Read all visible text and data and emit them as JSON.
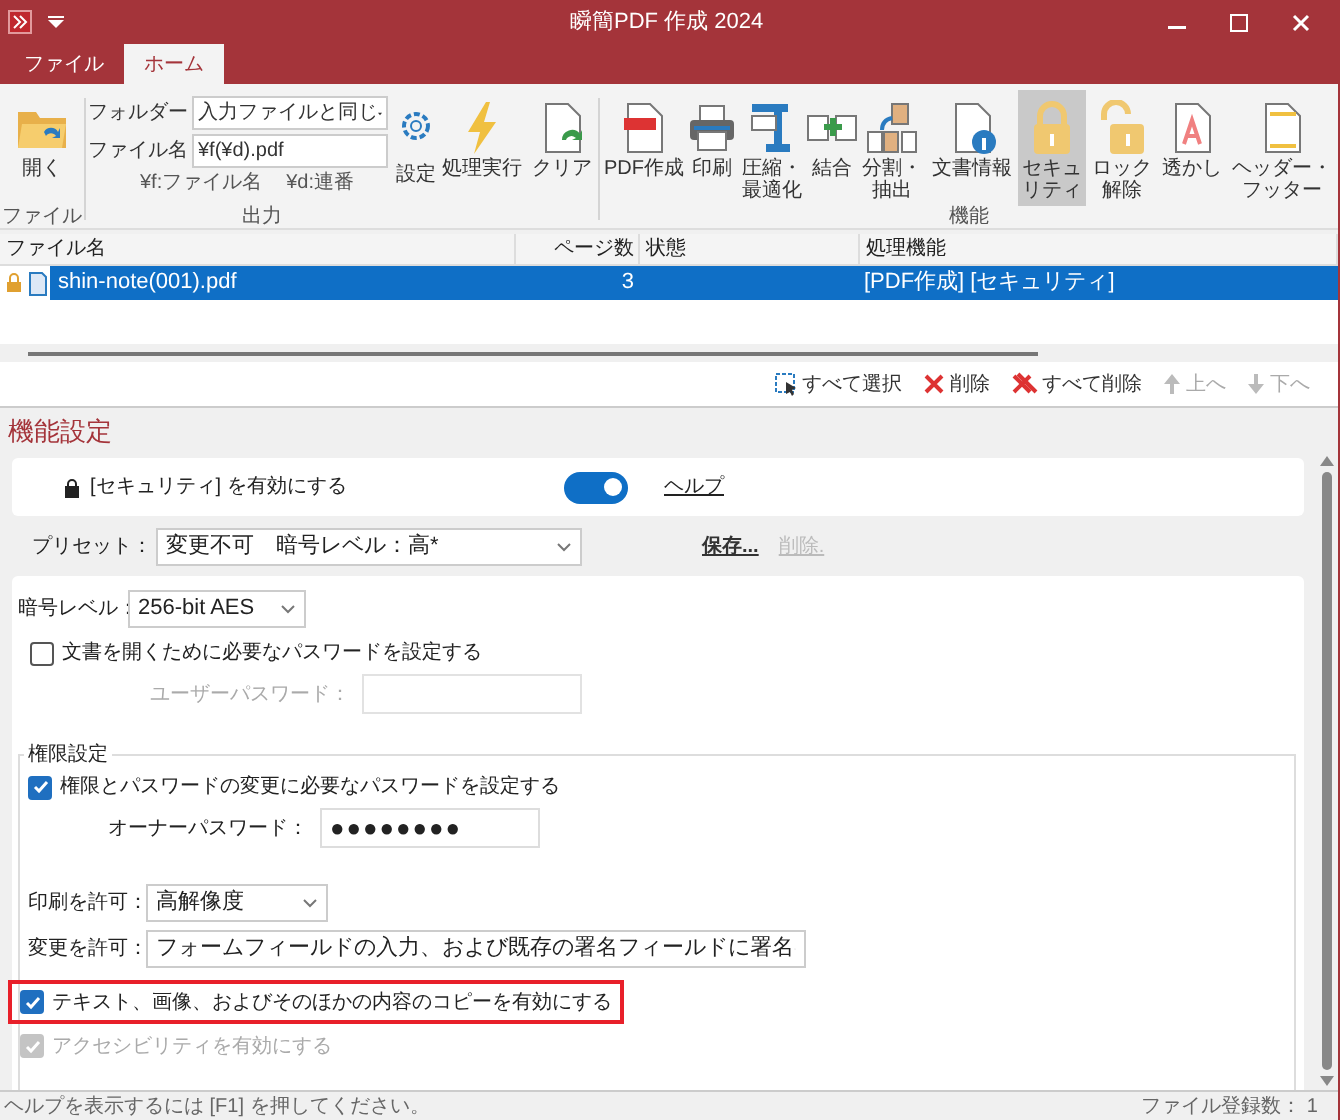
{
  "window": {
    "title": "瞬簡PDF 作成 2024"
  },
  "tabs": [
    {
      "label": "ファイル",
      "selected": false
    },
    {
      "label": "ホーム",
      "selected": true
    }
  ],
  "ribbon": {
    "groups": [
      {
        "kind": "buttons",
        "label": "ファイル",
        "buttons": [
          {
            "label": "開く",
            "selected": false
          }
        ]
      },
      {
        "kind": "output",
        "label": "出力",
        "folder_label": "フォルダー",
        "folder_value": "入力ファイルと同じ",
        "filename_label": "ファイル名",
        "filename_value": "¥f(¥d).pdf",
        "hints": [
          "¥f:ファイル名",
          "¥d:連番"
        ],
        "settings_button": "設定"
      },
      {
        "kind": "buttons",
        "buttons": [
          {
            "label": "処理実行",
            "selected": false
          },
          {
            "label": "クリア",
            "selected": false
          }
        ]
      },
      {
        "kind": "buttons",
        "label": "機能",
        "buttons": [
          {
            "label": "PDF作成",
            "selected": false
          },
          {
            "label": "印刷",
            "selected": false
          },
          {
            "label": "圧縮・最適化",
            "selected": false
          },
          {
            "label": "結合",
            "selected": false
          },
          {
            "label": "分割・抽出",
            "selected": false
          },
          {
            "label": "文書情報",
            "selected": false
          },
          {
            "label": "セキュリティ",
            "selected": true
          },
          {
            "label": "ロック解除",
            "selected": false
          },
          {
            "label": "透かし",
            "selected": false
          },
          {
            "label": "ヘッダー・フッター",
            "selected": false
          }
        ]
      }
    ]
  },
  "table": {
    "columns": [
      "ファイル名",
      "ページ数",
      "状態",
      "処理機能"
    ],
    "rows": [
      {
        "file": "shin-note(001).pdf",
        "pages": "3",
        "status": "",
        "functions": "[PDF作成] [セキュリティ]",
        "selected": true
      }
    ]
  },
  "list_toolbar": [
    {
      "label": "すべて選択",
      "disabled": false
    },
    {
      "label": "削除",
      "disabled": false
    },
    {
      "label": "すべて削除",
      "disabled": false
    },
    {
      "label": "上へ",
      "disabled": true
    },
    {
      "label": "下へ",
      "disabled": true
    }
  ],
  "settings": {
    "heading": "機能設定",
    "enable": {
      "label": "[セキュリティ] を有効にする",
      "on": true,
      "help": "ヘルプ"
    },
    "preset": {
      "label": "プリセット：",
      "value": "変更不可　暗号レベル：高*",
      "save": "保存...",
      "delete": "削除.",
      "delete_disabled": true
    },
    "encryption": {
      "label": "暗号レベル：",
      "value": "256-bit AES"
    },
    "open_password": {
      "label": "文書を開くために必要なパスワードを設定する",
      "checked": false,
      "field_label": "ユーザーパスワード：",
      "disabled": true
    },
    "permissions": {
      "legend": "権限設定",
      "owner": {
        "label": "権限とパスワードの変更に必要なパスワードを設定する",
        "checked": true,
        "field_label": "オーナーパスワード：",
        "value": "●●●●●●●●"
      },
      "print": {
        "label": "印刷を許可：",
        "value": "高解像度"
      },
      "change": {
        "label": "変更を許可：",
        "value": "フォームフィールドの入力、および既存の署名フィールドに署名"
      },
      "options": [
        {
          "label": "テキスト、画像、およびそのほかの内容のコピーを有効にする",
          "checked": true,
          "disabled": false,
          "highlighted": true
        },
        {
          "label": "アクセシビリティを有効にする",
          "checked": true,
          "disabled": true,
          "highlighted": false
        }
      ]
    }
  },
  "status_bar": {
    "hint": "ヘルプを表示するには [F1] を押してください。",
    "count": "ファイル登録数： 1"
  }
}
